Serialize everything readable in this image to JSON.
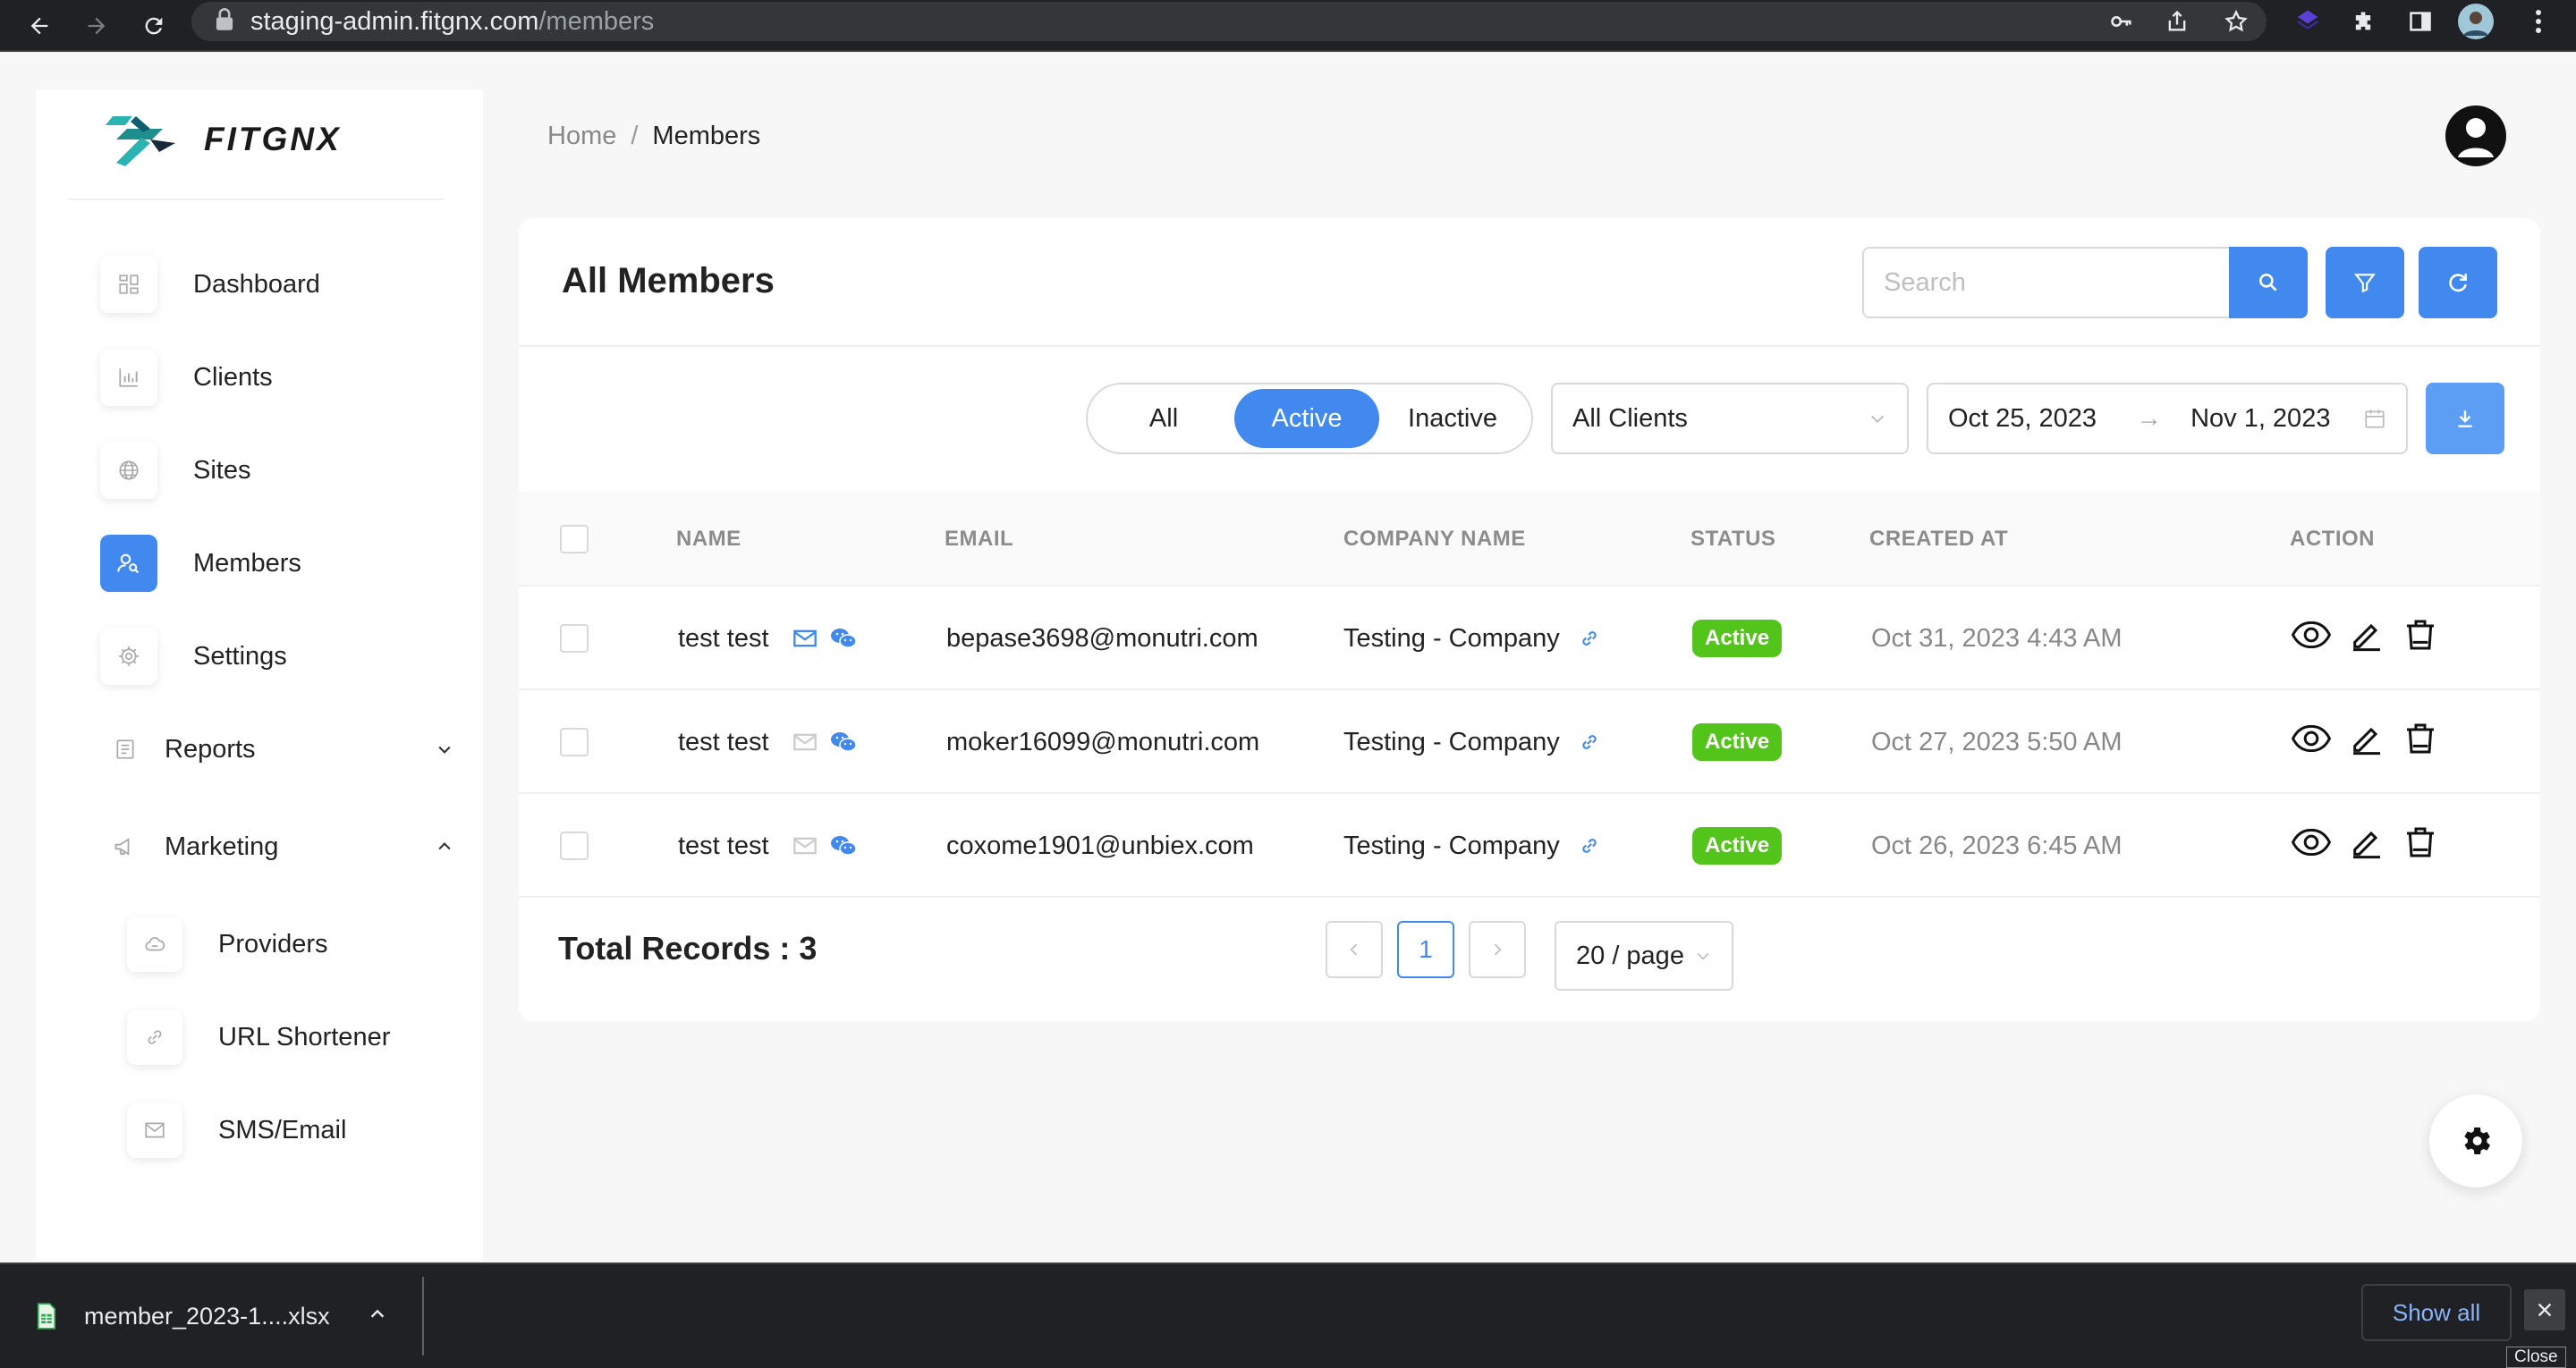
{
  "browser": {
    "url_host": "staging-admin.fitgnx.com",
    "url_path": "/members"
  },
  "sidebar": {
    "logo_text": "FITGNX",
    "items": [
      {
        "label": "Dashboard",
        "icon": "dashboard-icon"
      },
      {
        "label": "Clients",
        "icon": "bar-chart-icon"
      },
      {
        "label": "Sites",
        "icon": "globe-icon"
      },
      {
        "label": "Members",
        "icon": "members-icon",
        "active": true
      },
      {
        "label": "Settings",
        "icon": "gear-icon"
      }
    ],
    "groups": [
      {
        "label": "Reports",
        "icon": "report-icon",
        "expanded": false
      },
      {
        "label": "Marketing",
        "icon": "megaphone-icon",
        "expanded": true
      }
    ],
    "marketing_items": [
      {
        "label": "Providers",
        "icon": "cloud-icon"
      },
      {
        "label": "URL Shortener",
        "icon": "link-icon"
      },
      {
        "label": "SMS/Email",
        "icon": "mail-icon"
      }
    ]
  },
  "breadcrumb": {
    "home": "Home",
    "separator": "/",
    "current": "Members"
  },
  "card": {
    "title": "All Members",
    "search_placeholder": "Search",
    "filters": {
      "tabs": [
        "All",
        "Active",
        "Inactive"
      ],
      "selected_tab": "Active",
      "client_select": "All Clients",
      "date_from": "Oct 25, 2023",
      "date_to": "Nov 1, 2023"
    },
    "columns": [
      "NAME",
      "EMAIL",
      "COMPANY NAME",
      "STATUS",
      "CREATED AT",
      "ACTION"
    ],
    "rows": [
      {
        "name": "test test",
        "email": "bepase3698@monutri.com",
        "company": "Testing - Company",
        "status": "Active",
        "created_at": "Oct 31, 2023 4:43 AM",
        "email_verified": true
      },
      {
        "name": "test test",
        "email": "moker16099@monutri.com",
        "company": "Testing - Company",
        "status": "Active",
        "created_at": "Oct 27, 2023 5:50 AM",
        "email_verified": false
      },
      {
        "name": "test test",
        "email": "coxome1901@unbiex.com",
        "company": "Testing - Company",
        "status": "Active",
        "created_at": "Oct 26, 2023 6:45 AM",
        "email_verified": false
      }
    ],
    "total_label": "Total Records : 3",
    "pagination": {
      "current_page": "1",
      "page_size": "20 / page"
    }
  },
  "download_bar": {
    "file_name": "member_2023-1....xlsx",
    "show_all": "Show all",
    "close_tooltip": "Close"
  },
  "colors": {
    "primary": "#4189ef",
    "success": "#52c41a",
    "browser_dark": "#202124"
  }
}
